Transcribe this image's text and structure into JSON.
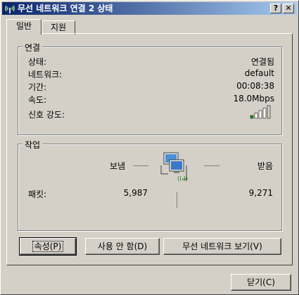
{
  "window": {
    "title": "무선 네트워크 연결 2 상태",
    "help_label": "?",
    "close_label": "✕"
  },
  "tabs": [
    {
      "label": "일반"
    },
    {
      "label": "지원"
    }
  ],
  "connection": {
    "group_label": "연결",
    "status_label": "상태:",
    "status_value": "연결됨",
    "network_label": "네트워크:",
    "network_value": "default",
    "duration_label": "기간:",
    "duration_value": "00:08:38",
    "speed_label": "속도:",
    "speed_value": "18.0Mbps",
    "signal_label": "신호 강도:",
    "signal_level": 0.8,
    "signal_color": "#00a000"
  },
  "activity": {
    "group_label": "작업",
    "sent_label": "보냄",
    "received_label": "받음",
    "packets_label": "패킷:",
    "packets_sent": "5,987",
    "packets_received": "9,271",
    "wifi_glyph": "((·))"
  },
  "buttons": {
    "properties": "속성(P)",
    "disable": "사용 안 함(D)",
    "view_wireless": "무선 네트워크 보기(V)",
    "close": "닫기(C)"
  }
}
